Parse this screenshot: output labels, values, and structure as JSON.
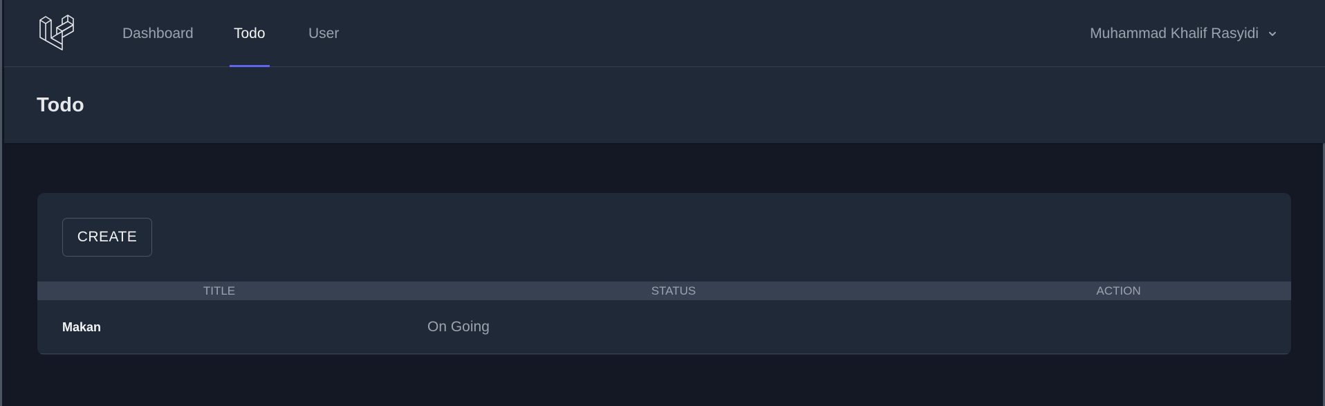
{
  "nav": {
    "logo_icon": "laravel-logo-icon",
    "links": [
      {
        "label": "Dashboard",
        "active": false
      },
      {
        "label": "Todo",
        "active": true
      },
      {
        "label": "User",
        "active": false
      }
    ],
    "user_name": "Muhammad Khalif Rasyidi",
    "user_menu_icon": "chevron-down-icon",
    "accent_color": "#6366f1"
  },
  "header": {
    "title": "Todo"
  },
  "todo": {
    "create_label": "CREATE",
    "columns": [
      "TITLE",
      "STATUS",
      "ACTION"
    ],
    "rows": [
      {
        "title": "Makan",
        "status": "On Going",
        "action": ""
      }
    ]
  }
}
